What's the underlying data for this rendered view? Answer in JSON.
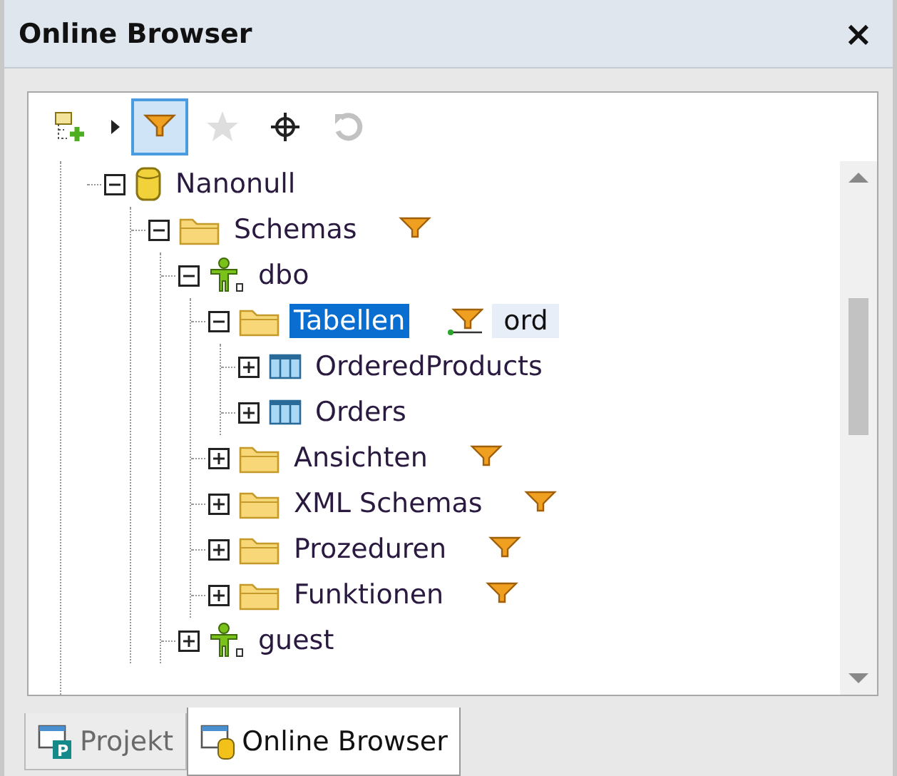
{
  "window": {
    "title": "Online Browser",
    "close": "×"
  },
  "toolbar": [
    {
      "kind": "add",
      "pressed": false,
      "disabled": false
    },
    {
      "kind": "menu-arrow",
      "pressed": false,
      "disabled": false
    },
    {
      "kind": "filter",
      "pressed": true,
      "disabled": false
    },
    {
      "kind": "favorite",
      "pressed": false,
      "disabled": true
    },
    {
      "kind": "locate",
      "pressed": false,
      "disabled": false
    },
    {
      "kind": "refresh",
      "pressed": false,
      "disabled": true
    }
  ],
  "tree": [
    {
      "label": "Nanonull",
      "kind": "database",
      "expanded": true,
      "selected": false,
      "has_filter": false,
      "filter_applied": false,
      "children": [
        {
          "label": "Schemas",
          "kind": "folder",
          "expanded": true,
          "selected": false,
          "has_filter": true,
          "filter_applied": false,
          "children": [
            {
              "label": "dbo",
              "kind": "schema",
              "expanded": true,
              "selected": false,
              "has_filter": false,
              "filter_applied": false,
              "children": [
                {
                  "label": "Tabellen",
                  "kind": "folder",
                  "expanded": true,
                  "selected": true,
                  "has_filter": true,
                  "filter_applied": true,
                  "filter_value": "ord",
                  "children": [
                    {
                      "label": "OrderedProducts",
                      "kind": "table",
                      "expanded": false,
                      "selected": false,
                      "has_filter": false,
                      "filter_applied": false
                    },
                    {
                      "label": "Orders",
                      "kind": "table",
                      "expanded": false,
                      "selected": false,
                      "has_filter": false,
                      "filter_applied": false
                    }
                  ]
                },
                {
                  "label": "Ansichten",
                  "kind": "folder",
                  "expanded": false,
                  "selected": false,
                  "has_filter": true,
                  "filter_applied": false
                },
                {
                  "label": "XML Schemas",
                  "kind": "folder",
                  "expanded": false,
                  "selected": false,
                  "has_filter": true,
                  "filter_applied": false
                },
                {
                  "label": "Prozeduren",
                  "kind": "folder",
                  "expanded": false,
                  "selected": false,
                  "has_filter": true,
                  "filter_applied": false
                },
                {
                  "label": "Funktionen",
                  "kind": "folder",
                  "expanded": false,
                  "selected": false,
                  "has_filter": true,
                  "filter_applied": false
                }
              ]
            },
            {
              "label": "guest",
              "kind": "schema",
              "expanded": false,
              "selected": false,
              "has_filter": false,
              "filter_applied": false
            }
          ]
        }
      ]
    }
  ],
  "tabs": [
    {
      "label": "Projekt",
      "kind": "project",
      "icon_letter": "P",
      "selected": false
    },
    {
      "label": "Online Browser",
      "kind": "browser",
      "selected": true
    }
  ]
}
